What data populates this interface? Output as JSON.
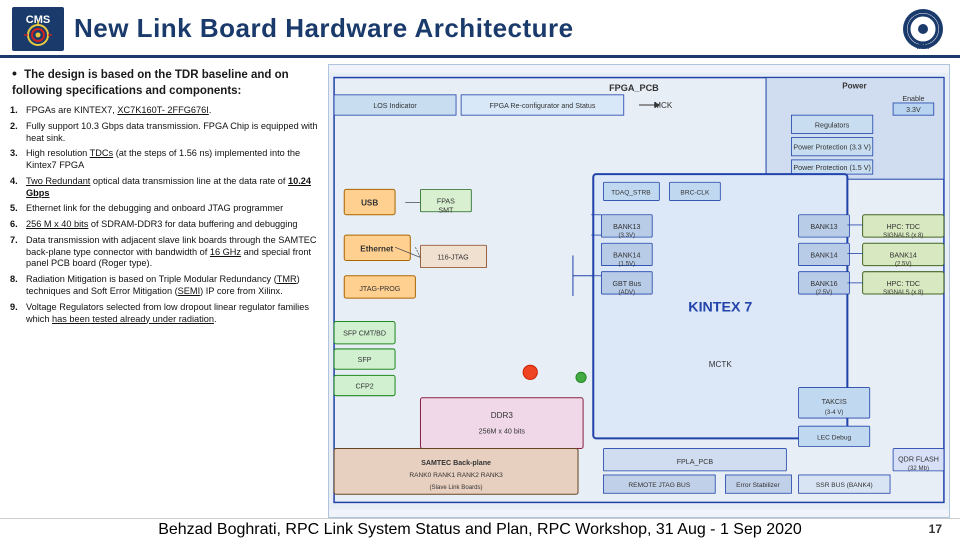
{
  "header": {
    "title": "New Link Board Hardware Architecture",
    "cms_logo_alt": "CMS Logo",
    "ipm_logo_alt": "IPM Logo"
  },
  "intro": {
    "bullet": "•",
    "text": "The design is based on the TDR baseline and on following specifications and components:"
  },
  "items": [
    {
      "num": "1.",
      "text": "FPGAs are KINTEX7, XC7K160T- 2FFG676I."
    },
    {
      "num": "2.",
      "text": "Fully support 10.3 Gbps data transmission. FPGA Chip is equipped with heat sink."
    },
    {
      "num": "3.",
      "text": "High resolution TDCs (at the steps of 1.56 ns) implemented into the Kintex7 FPGA"
    },
    {
      "num": "4.",
      "text": "Two Redundant optical data transmission line at the data rate of 10.24 Gbps"
    },
    {
      "num": "5.",
      "text": "Ethernet link for the debugging and onboard JTAG programmer"
    },
    {
      "num": "6.",
      "text": "256 M x 40 bits of SDRAM-DDR3 for data buffering and debugging"
    },
    {
      "num": "7.",
      "text": "Data transmission with adjacent slave link boards through the SAMTEC back-plane type connector with bandwidth of 16 GHz and special front panel PCB board (Roger type)."
    },
    {
      "num": "8.",
      "text": "Radiation Mitigation is based on Triple Modular Redundancy (TMR) techniques and Soft Error Mitigation (SEMI) IP core from Xilinx."
    },
    {
      "num": "9.",
      "text": "Voltage Regulators selected from low dropout linear regulator families which has been tested already under radiation."
    }
  ],
  "footer": {
    "text": "Behzad Boghrati, RPC Link System Status and Plan, RPC Workshop, 31 Aug - 1 Sep 2020",
    "page_num": "17"
  }
}
